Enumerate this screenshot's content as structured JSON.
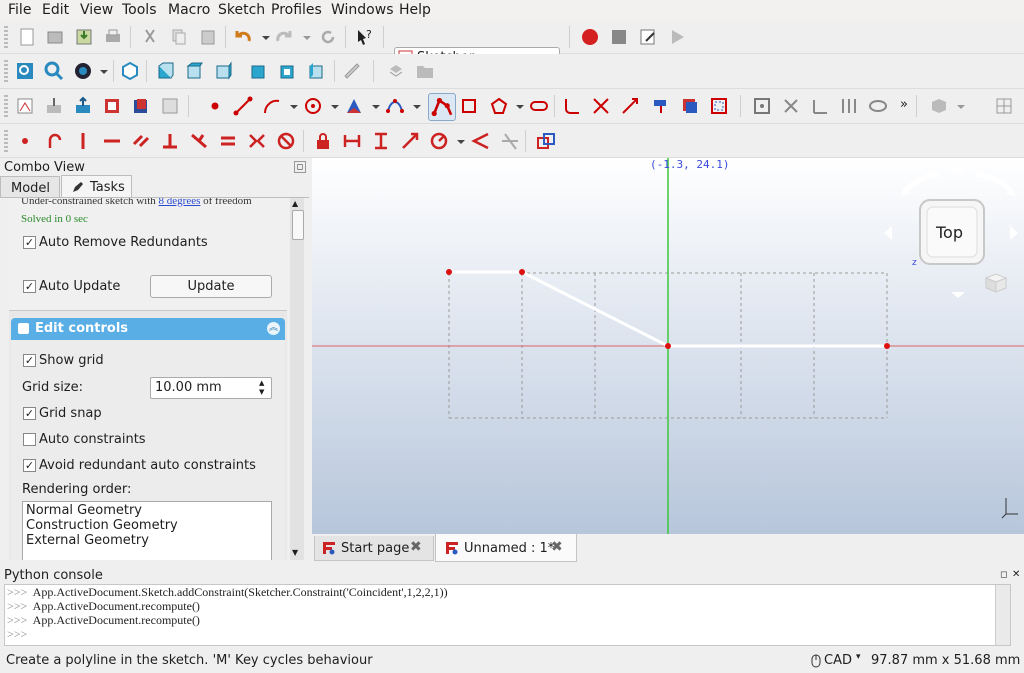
{
  "menu": [
    "File",
    "Edit",
    "View",
    "Tools",
    "Macro",
    "Sketch",
    "Profiles",
    "Windows",
    "Help"
  ],
  "workbench": {
    "selected": "Sketcher"
  },
  "combo_view": {
    "title": "Combo View",
    "tabs": [
      "Model",
      "Tasks"
    ],
    "solver_text": "Under-constrained sketch with ",
    "solver_link": "8 degrees",
    "solver_suffix": " of freedom",
    "solved_text": "Solved in 0 sec",
    "auto_remove": "Auto Remove Redundants",
    "auto_update": "Auto Update",
    "update_button": "Update",
    "edit_controls_title": "Edit controls",
    "show_grid": "Show grid",
    "grid_size_label": "Grid size:",
    "grid_size_value": "10.00 mm",
    "grid_snap": "Grid snap",
    "auto_constraints": "Auto constraints",
    "avoid_redundant": "Avoid redundant auto constraints",
    "rendering_order_label": "Rendering order:",
    "rendering_order": [
      "Normal Geometry",
      "Construction Geometry",
      "External Geometry"
    ]
  },
  "viewport": {
    "coordinates": "(-1.3, 24.1)",
    "navcube_face": "Top",
    "axis_z": "z"
  },
  "doc_tabs": [
    {
      "label": "Start page"
    },
    {
      "label": "Unnamed : 1*"
    }
  ],
  "console": {
    "title": "Python console",
    "prompt": ">>>",
    "lines": [
      "App.ActiveDocument.Sketch.addConstraint(Sketcher.Constraint('Coincident',1,2,2,1))",
      "App.ActiveDocument.recompute()",
      "App.ActiveDocument.recompute()",
      ""
    ]
  },
  "status": {
    "message": "Create a polyline in the sketch. 'M' Key cycles behaviour",
    "nav_style": "CAD",
    "dimensions": "97.87 mm x 51.68 mm"
  },
  "colors": {
    "accent": "#5aaee6",
    "sketch_red": "#cc0000",
    "constraint_red": "#cc2222",
    "y_axis": "#3cc83c",
    "x_axis": "#dc6464"
  }
}
